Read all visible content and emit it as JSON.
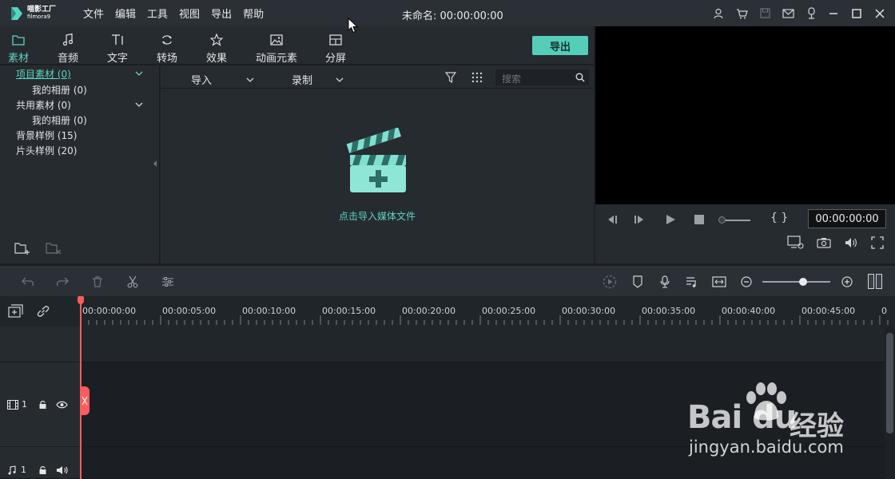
{
  "app": {
    "logo_cn": "喵影工厂",
    "logo_en": "filmora9",
    "menu": [
      "文件",
      "编辑",
      "工具",
      "视图",
      "导出",
      "帮助"
    ],
    "doc_title": "未命名: 00:00:00:00"
  },
  "tabs": [
    {
      "label": "素材",
      "icon": "folder-icon",
      "active": true
    },
    {
      "label": "音频",
      "icon": "music-note-icon"
    },
    {
      "label": "文字",
      "icon": "text-icon"
    },
    {
      "label": "转场",
      "icon": "transition-icon"
    },
    {
      "label": "效果",
      "icon": "effects-icon"
    },
    {
      "label": "动画元素",
      "icon": "image-icon"
    },
    {
      "label": "分屏",
      "icon": "split-screen-icon"
    }
  ],
  "export_label": "导出",
  "library": {
    "items": [
      {
        "label": "项目素材 (0)",
        "selected": true
      },
      {
        "label": "我的相册 (0)"
      },
      {
        "label": "共用素材 (0)"
      },
      {
        "label": "我的相册 (0)"
      },
      {
        "label": "背景样例 (15)"
      },
      {
        "label": "片头样例 (20)"
      }
    ]
  },
  "browser": {
    "import_label": "导入",
    "record_label": "录制",
    "search_placeholder": "搜索",
    "hint": "点击导入媒体文件"
  },
  "preview": {
    "timecode": "00:00:00:00",
    "brackets": "{ }"
  },
  "ruler": {
    "labels": [
      "00:00:00:00",
      "00:00:05:00",
      "00:00:10:00",
      "00:00:15:00",
      "00:00:20:00",
      "00:00:25:00",
      "00:00:30:00",
      "00:00:35:00",
      "00:00:40:00",
      "00:00:45:00",
      "0"
    ]
  },
  "tracks": {
    "video_label": "1",
    "audio_label": "1"
  },
  "watermark": {
    "logo": "Bai du",
    "cn": "经验",
    "url": "jingyan.baidu.com"
  },
  "colors": {
    "accent": "#54cdb9",
    "playhead": "#ff5c5c"
  }
}
